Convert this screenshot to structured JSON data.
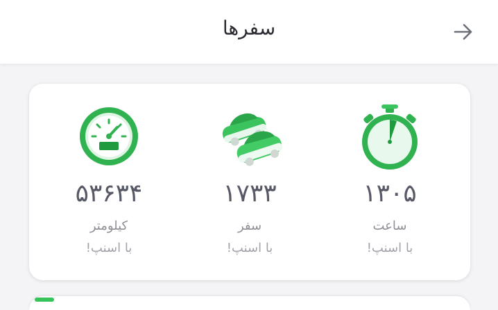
{
  "header": {
    "title": "سفرها",
    "back_icon": "arrow-right-icon"
  },
  "stats": [
    {
      "value": "۱۳۰۵",
      "label": "ساعت",
      "sub": "با اسنپ!",
      "icon": "stopwatch-icon"
    },
    {
      "value": "۱۷۳۳",
      "label": "سفر",
      "sub": "با اسنپ!",
      "icon": "cars-icon"
    },
    {
      "value": "۵۳۶۳۴",
      "label": "کیلومتر",
      "sub": "با اسنپ!",
      "icon": "speedometer-icon"
    }
  ],
  "colors": {
    "brand_green": "#36c45a",
    "dark_green": "#1f9a3f",
    "value_text": "#575a66"
  }
}
